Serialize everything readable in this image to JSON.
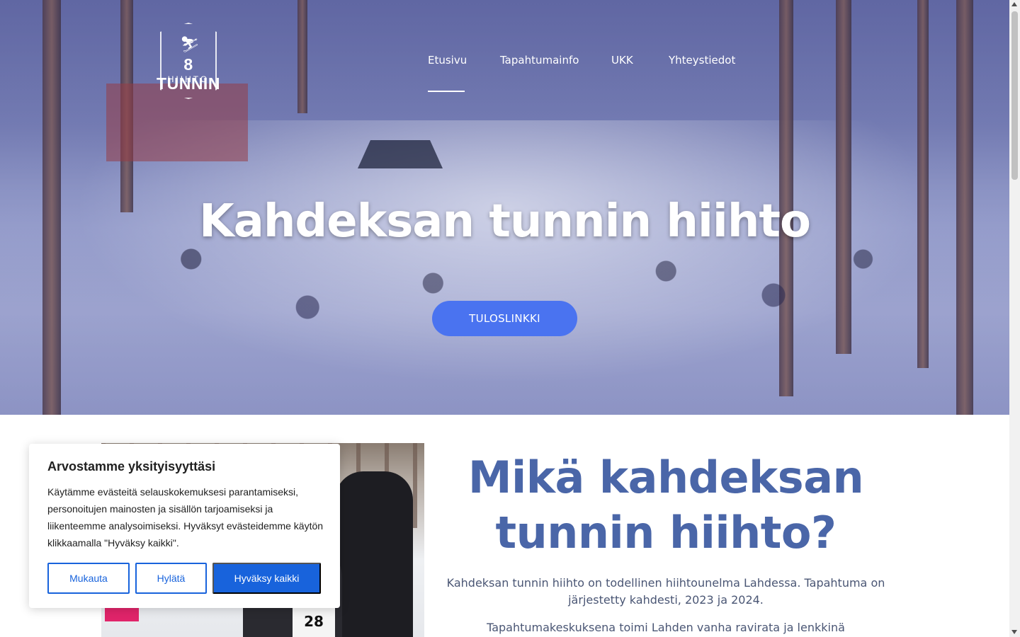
{
  "logo": {
    "line1": "8 TUNNIN",
    "line2": "HIIHTO",
    "icon": "skier-icon"
  },
  "nav": {
    "items": [
      {
        "label": "Etusivu",
        "active": true
      },
      {
        "label": "Tapahtumainfo",
        "active": false
      },
      {
        "label": "UKK",
        "active": false
      },
      {
        "label": "Yhteystiedot",
        "active": false
      }
    ]
  },
  "hero": {
    "title": "Kahdeksan tunnin hiihto",
    "button_label": "TULOSLINKKI",
    "button_color": "#4a73f0",
    "overlay_color": "#5a64b4"
  },
  "photo": {
    "bib_number": "28"
  },
  "about": {
    "title_line1": "Mikä kahdeksan",
    "title_line2": "tunnin hiihto?",
    "title_color": "#4a66a8",
    "paragraph1": "Kahdeksan tunnin hiihto on todellinen hiihtounelma Lahdessa. Tapahtuma on järjestetty kahdesti, 2023 ja 2024.",
    "paragraph2": "Tapahtumakeskuksena toimi Lahden vanha ravirata ja lenkkinä ensilumenlatu"
  },
  "cookie_banner": {
    "title": "Arvostamme yksityisyyttäsi",
    "body": "Käytämme evästeitä selauskokemuksesi parantamiseksi, personoitujen mainosten ja sisällön tarjoamiseksi ja liikenteemme analysoimiseksi. Hyväksyt evästeidemme käytön klikkaamalla \"Hyväksy kaikki\".",
    "customize_label": "Mukauta",
    "reject_label": "Hylätä",
    "accept_label": "Hyväksy kaikki",
    "accent_color": "#1863dc"
  }
}
